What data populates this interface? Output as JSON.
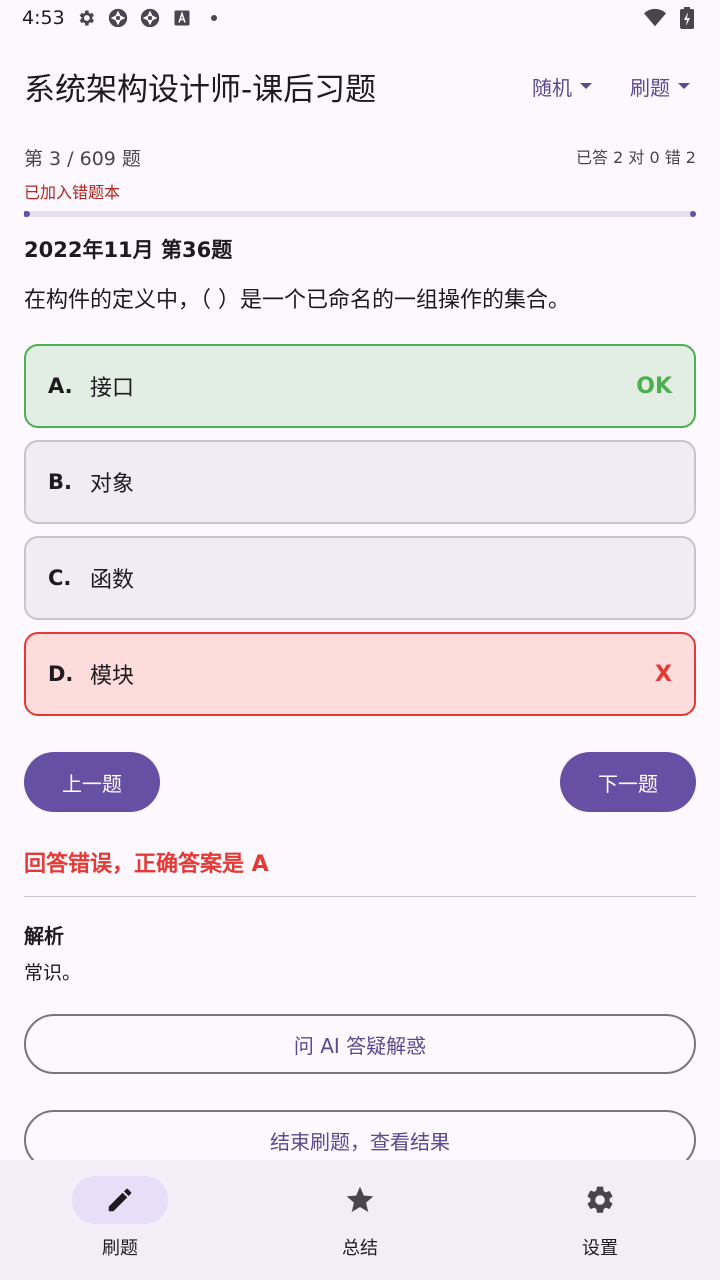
{
  "status_bar": {
    "time": "4:53"
  },
  "app_bar": {
    "title": "系统架构设计师-课后习题",
    "mode_dropdown": "随机",
    "type_dropdown": "刷题"
  },
  "progress": {
    "count_text": "第 3 / 609 题",
    "added_note": "已加入错题本",
    "stats_text": "已答 2 对 0 错 2",
    "fraction": 0.005
  },
  "question": {
    "source": "2022年11月 第36题",
    "text": "在构件的定义中，（ ）是一个已命名的一组操作的集合。"
  },
  "options": [
    {
      "letter": "A.",
      "text": "接口",
      "mark": "OK",
      "state": "correct"
    },
    {
      "letter": "B.",
      "text": "对象",
      "mark": "",
      "state": "normal"
    },
    {
      "letter": "C.",
      "text": "函数",
      "mark": "",
      "state": "normal"
    },
    {
      "letter": "D.",
      "text": "模块",
      "mark": "X",
      "state": "wrong"
    }
  ],
  "navigation": {
    "prev_label": "上一题",
    "next_label": "下一题"
  },
  "result": {
    "text": "回答错误，正确答案是 A",
    "analysis_title": "解析",
    "analysis_text": "常识。"
  },
  "actions": {
    "ask_ai_label": "问 AI 答疑解惑",
    "finish_label": "结束刷题，查看结果"
  },
  "bottom_nav": [
    {
      "label": "刷题",
      "icon": "pencil-icon",
      "active": true
    },
    {
      "label": "总结",
      "icon": "star-icon",
      "active": false
    },
    {
      "label": "设置",
      "icon": "gear-icon",
      "active": false
    }
  ],
  "colors": {
    "accent": "#6750a4",
    "correct": "#4caf50",
    "wrong": "#e53935",
    "note_red": "#b3261e"
  }
}
